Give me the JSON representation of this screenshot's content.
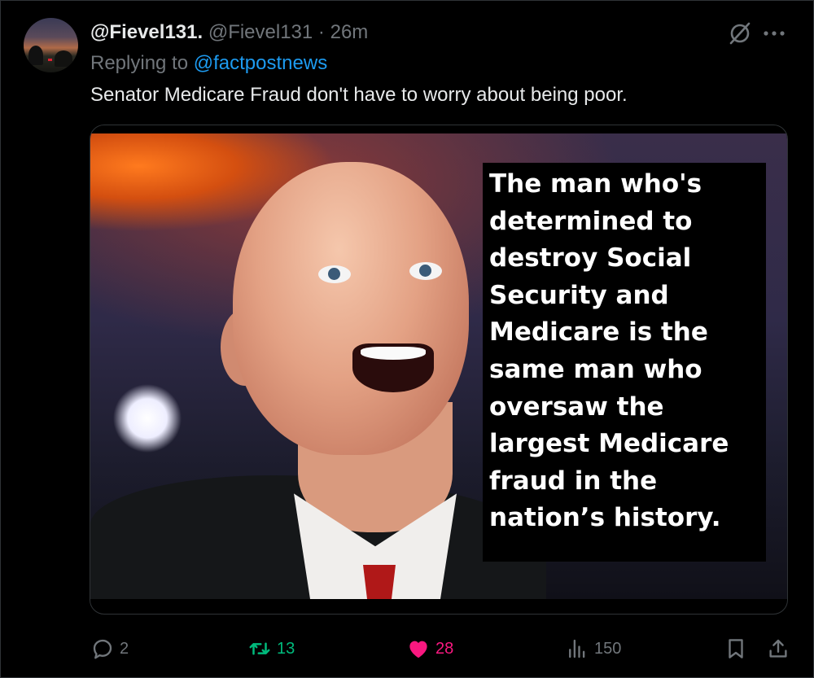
{
  "tweet": {
    "display_name": "@Fievel131.",
    "handle": "@Fievel131",
    "separator": " · ",
    "time": "26m",
    "replying_to_label": "Replying to",
    "replying_to_handle": "@factpostnews",
    "text": "Senator Medicare Fraud don't have to worry about being poor."
  },
  "media": {
    "overlay_text": "The man who's\ndetermined to\ndestroy Social\nSecurity and\nMedicare is the\nsame man who\noversaw the\nlargest Medicare\nfraud in the\nnation’s history."
  },
  "actions": {
    "replies": "2",
    "reposts": "13",
    "likes": "28",
    "views": "150"
  },
  "icons": {
    "reply": "reply-icon",
    "repost": "repost-icon",
    "like": "heart-icon",
    "views": "views-icon",
    "bookmark": "bookmark-icon",
    "share": "share-icon",
    "grok": "grok-icon",
    "more": "more-icon"
  },
  "colors": {
    "background": "#000000",
    "text": "#e7e9ea",
    "muted": "#71767b",
    "link": "#1d9bf0",
    "repost": "#00ba7c",
    "like": "#f91880"
  }
}
